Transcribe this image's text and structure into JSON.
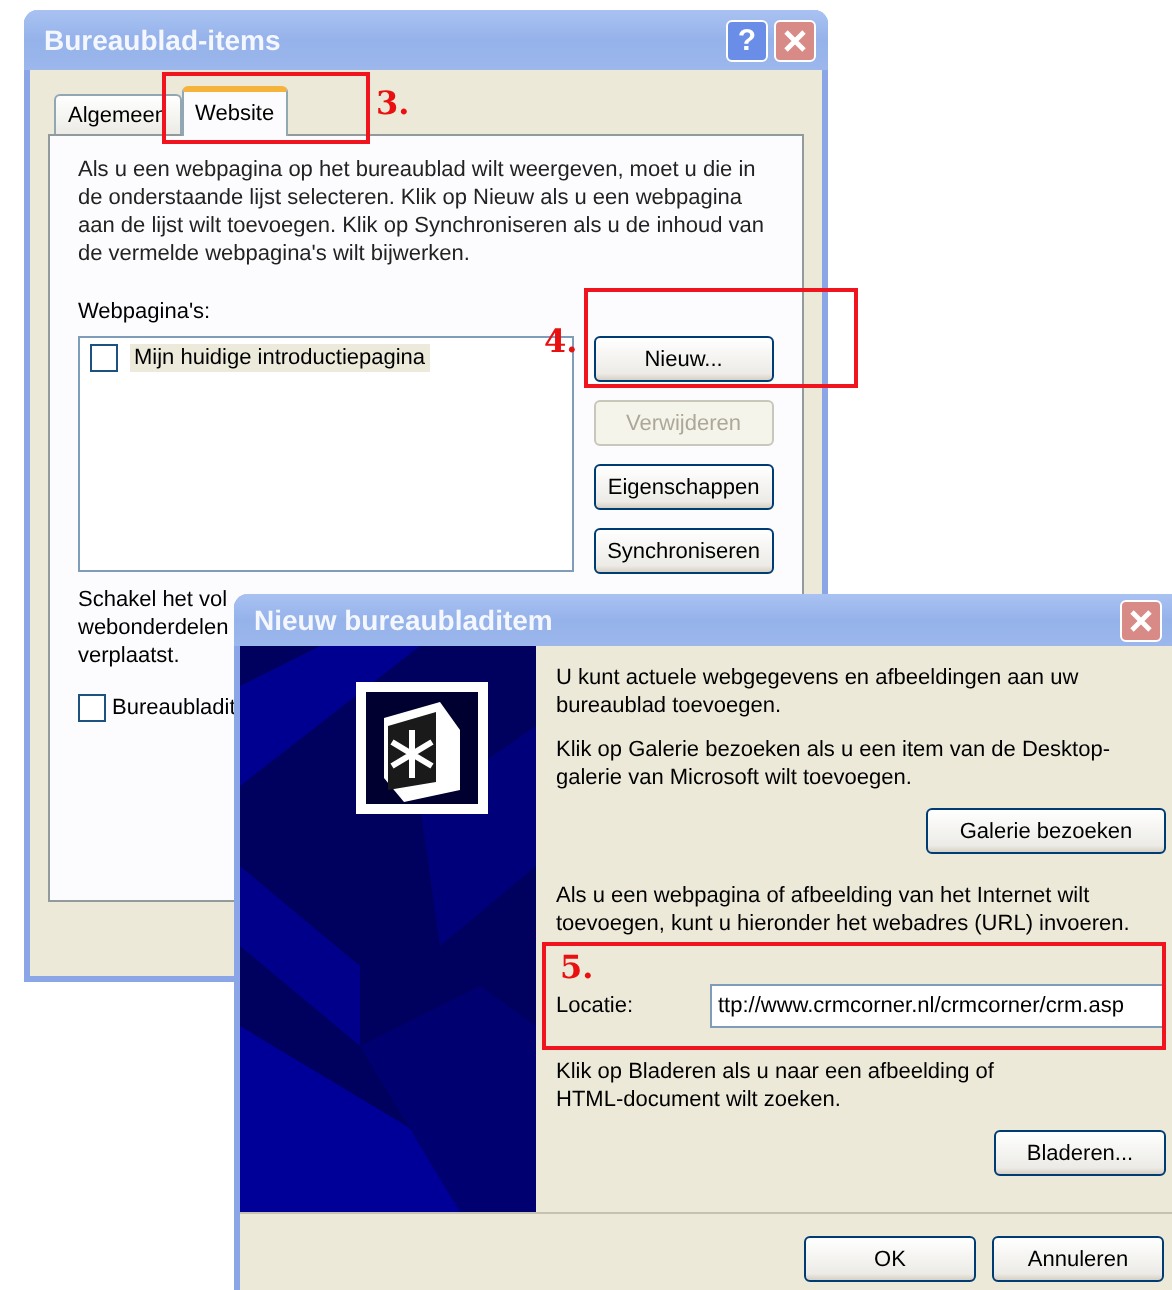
{
  "main_window": {
    "title": "Bureaublad-items",
    "help_button": "?",
    "tabs": [
      {
        "label": "Algemeen",
        "selected": false
      },
      {
        "label": "Website",
        "selected": true
      }
    ],
    "intro": "Als u een webpagina op het bureaublad wilt weergeven, moet u die in de onderstaande lijst selecteren. Klik op Nieuw als u een webpagina aan de lijst wilt toevoegen. Klik op Synchroniseren als u de inhoud van de vermelde webpagina's wilt bijwerken.",
    "list_label": "Webpagina's:",
    "pages": [
      {
        "label": "Mijn huidige introductiepagina",
        "checked": false
      }
    ],
    "buttons": [
      {
        "label": "Nieuw...",
        "disabled": false
      },
      {
        "label": "Verwijderen",
        "disabled": true
      },
      {
        "label": "Eigenschappen",
        "disabled": false
      },
      {
        "label": "Synchroniseren",
        "disabled": false
      }
    ],
    "lower_text_lines": [
      "Schakel het vol",
      "webonderdelen",
      "verplaatst."
    ],
    "lock_option": {
      "label": "Bureaubladit",
      "checked": false
    }
  },
  "dialog": {
    "title": "Nieuw bureaubladitem",
    "intro": "U kunt actuele webgegevens en afbeeldingen aan uw bureaublad toevoegen.",
    "gallery_text": "Klik op Galerie bezoeken als u een item van de Desktop-galerie van Microsoft wilt toevoegen.",
    "gallery_button": "Galerie bezoeken",
    "url_text": "Als u een webpagina of afbeelding van het Internet wilt toevoegen, kunt u hieronder het webadres (URL) invoeren.",
    "location_label": "Locatie:",
    "location_value": "ttp://www.crmcorner.nl/crmcorner/crm.asp",
    "browse_text": "Klik op Bladeren als u naar een afbeelding of HTML-document wilt zoeken.",
    "browse_button": "Bladeren...",
    "buttons": [
      "OK",
      "Annuleren"
    ]
  },
  "annotations": [
    {
      "label": "3."
    },
    {
      "label": "4."
    },
    {
      "label": "5."
    }
  ]
}
